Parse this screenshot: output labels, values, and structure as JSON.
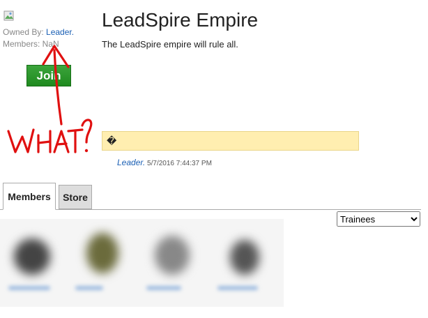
{
  "sidebar": {
    "owned_by_label": "Owned By: ",
    "owner_name": "Leader.",
    "members_text": "Members: NaN",
    "join_label": "Join"
  },
  "group": {
    "title": "LeadSpire Empire",
    "description": "The LeadSpire empire will rule all."
  },
  "shout": {
    "text": "�",
    "author": "Leader.",
    "timestamp": "5/7/2016 7:44:37 PM"
  },
  "annotation": {
    "text": "WHAT?",
    "color": "#e01010"
  },
  "tabs": [
    {
      "label": "Members",
      "active": true
    },
    {
      "label": "Store",
      "active": false
    }
  ],
  "rank_select": {
    "selected": "Trainees"
  },
  "colors": {
    "join_button": "#2a9a2a",
    "shout_background": "#ffeeb0",
    "link": "#1a5fb4"
  }
}
